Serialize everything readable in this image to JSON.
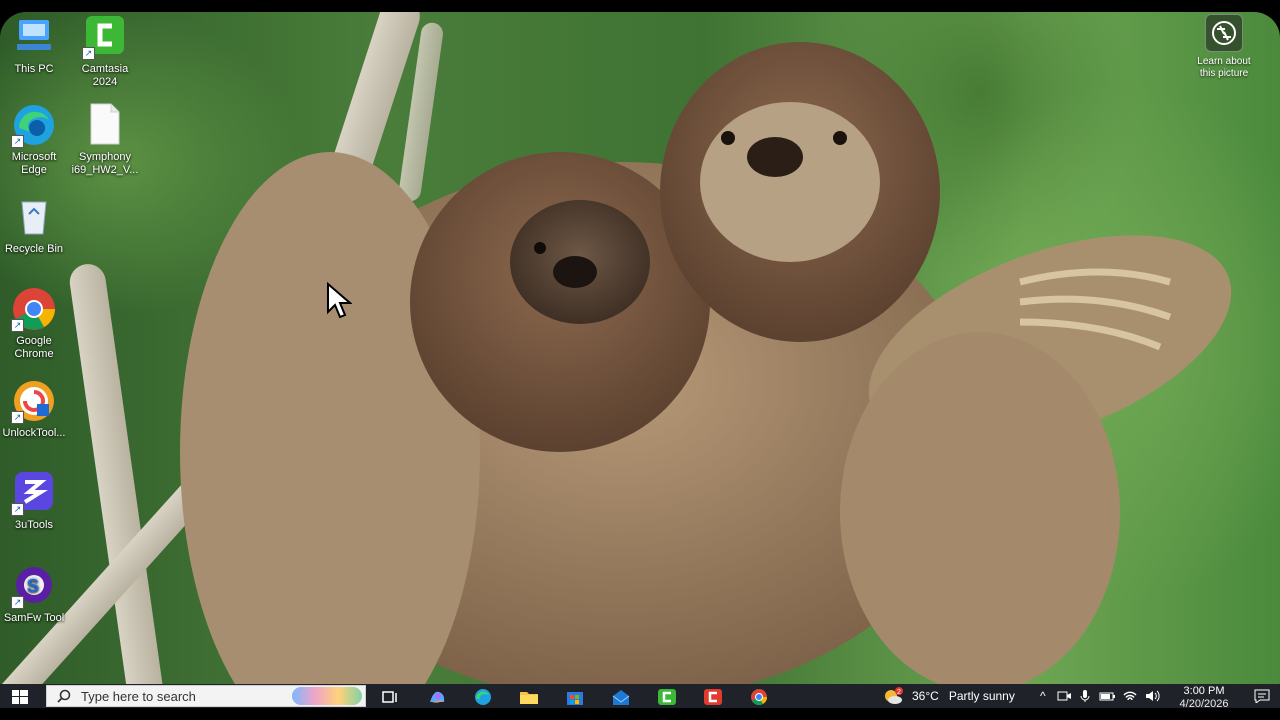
{
  "desktop": {
    "icons": [
      {
        "label": "This PC",
        "icon": "computer-icon"
      },
      {
        "label": "Camtasia\n2024",
        "icon": "camtasia-icon"
      },
      {
        "label": "Microsoft\nEdge",
        "icon": "edge-icon"
      },
      {
        "label": "Symphony\ni69_HW2_V...",
        "icon": "file-icon"
      },
      {
        "label": "Recycle Bin",
        "icon": "recycle-bin-icon"
      },
      {
        "label": "Google\nChrome",
        "icon": "chrome-icon"
      },
      {
        "label": "UnlockTool...",
        "icon": "unlocktool-icon"
      },
      {
        "label": "3uTools",
        "icon": "3utools-icon"
      },
      {
        "label": "SamFw Tool",
        "icon": "samfw-icon"
      }
    ],
    "learn_picture": {
      "label": "Learn about\nthis picture",
      "icon": "camera-icon"
    }
  },
  "taskbar": {
    "search_placeholder": "Type here to search",
    "weather": {
      "temp": "36°C",
      "condition": "Partly sunny",
      "badge": "2"
    },
    "clock": {
      "time": "3:00 PM",
      "date": "4/20/2026"
    },
    "icons": [
      "start-icon",
      "search-icon",
      "task-view-icon",
      "copilot-icon",
      "edge-icon",
      "file-explorer-icon",
      "store-icon",
      "mail-icon",
      "camtasia-icon",
      "camtasia-recorder-icon",
      "chrome-icon"
    ]
  },
  "colors": {
    "taskbar": "#1f2329",
    "accent": "#0078d4"
  }
}
